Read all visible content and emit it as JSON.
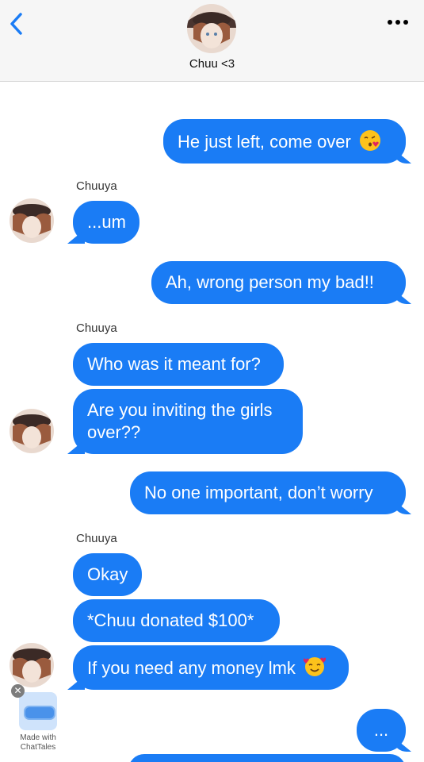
{
  "header": {
    "contact_name": "Chuu <3",
    "back_icon": "chevron-left-icon",
    "more_icon": "ellipsis-icon"
  },
  "colors": {
    "bubble": "#1a7cf5",
    "header_bg": "#f6f6f6",
    "accent": "#1a7cf5"
  },
  "messages": [
    {
      "from": "me",
      "text": "He just left, come over",
      "emoji": "kissing-face-emoji"
    },
    {
      "from": "Chuuya",
      "sender_label": "Chuuya",
      "text": "...um"
    },
    {
      "from": "me",
      "text": "Ah, wrong person my bad!!"
    },
    {
      "from": "Chuuya",
      "sender_label": "Chuuya",
      "text": "Who was it meant for?"
    },
    {
      "from": "Chuuya",
      "text_line1": "Are you inviting the girls",
      "text_line2": "over??"
    },
    {
      "from": "me",
      "text": "No one important, don’t worry"
    },
    {
      "from": "Chuuya",
      "sender_label": "Chuuya",
      "text": "Okay"
    },
    {
      "from": "Chuuya",
      "text": "*Chuu donated $100*"
    },
    {
      "from": "Chuuya",
      "text": "If you need any money lmk",
      "emoji": "smiling-face-with-hearts-emoji"
    },
    {
      "from": "me",
      "text": "..."
    }
  ],
  "watermark": {
    "line1": "Made with",
    "line2": "ChatTales",
    "close_glyph": "✕"
  }
}
